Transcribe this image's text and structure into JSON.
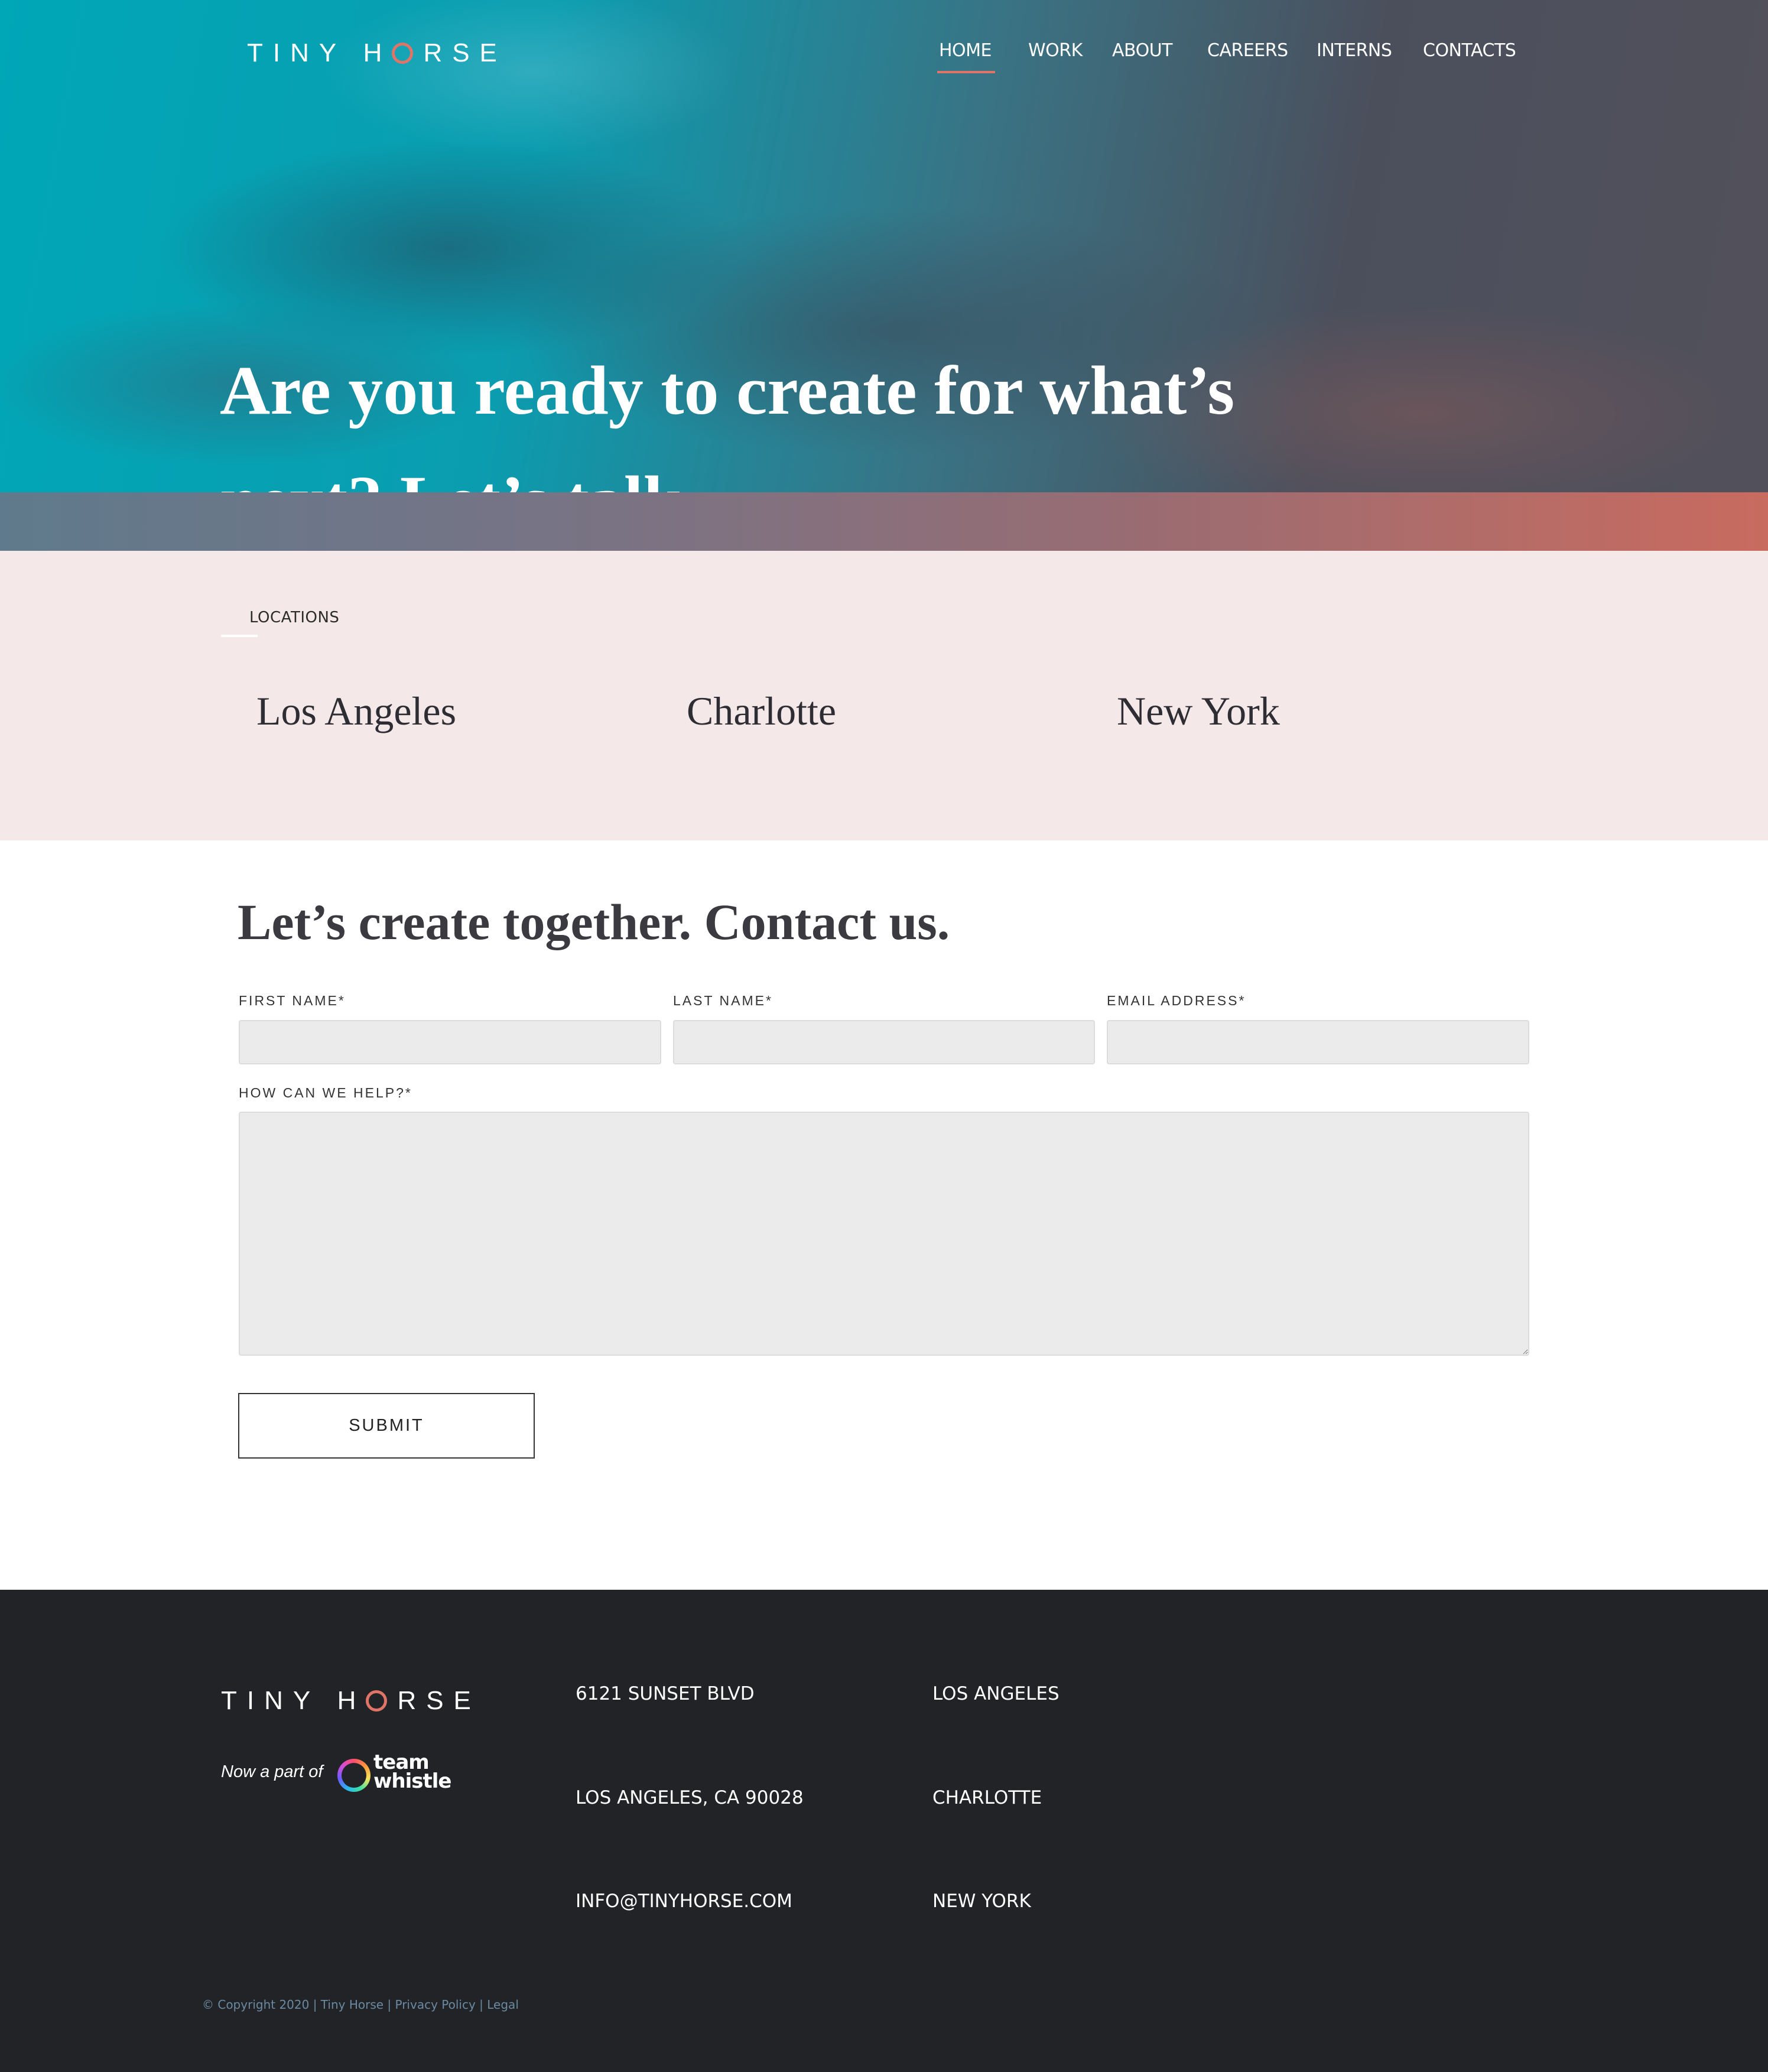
{
  "header": {
    "logo": {
      "before_o": "TINY H",
      "after_o": "RSE"
    },
    "nav": [
      {
        "label": "HOME",
        "active": true
      },
      {
        "label": "WORK",
        "active": false
      },
      {
        "label": "ABOUT",
        "active": false
      },
      {
        "label": "CAREERS",
        "active": false
      },
      {
        "label": "INTERNS",
        "active": false
      },
      {
        "label": "CONTACTS",
        "active": false
      }
    ]
  },
  "hero": {
    "heading": "Are you ready to create for what’s next? Let’s talk."
  },
  "locations": {
    "label": "LOCATIONS",
    "cities": [
      "Los Angeles",
      "Charlotte",
      "New York"
    ]
  },
  "contact_form": {
    "title": "Let’s create together. Contact us.",
    "first_name": {
      "label": "FIRST NAME*",
      "value": ""
    },
    "last_name": {
      "label": "LAST NAME*",
      "value": ""
    },
    "email": {
      "label": "EMAIL ADDRESS*",
      "value": ""
    },
    "message": {
      "label": "HOW CAN WE HELP?*",
      "value": ""
    },
    "submit_label": "SUBMIT"
  },
  "footer": {
    "logo": {
      "before_o": "TINY H",
      "after_o": "RSE"
    },
    "now_part_of": "Now a part of",
    "partner": {
      "line1": "team",
      "line2": "whistle"
    },
    "address": [
      "6121 SUNSET BLVD",
      "LOS ANGELES, CA 90028",
      "INFO@TINYHORSE.COM"
    ],
    "cities": [
      "LOS ANGELES",
      "CHARLOTTE",
      "NEW YORK"
    ],
    "copyright": "© Copyright 2020 | Tiny Horse | ",
    "privacy": "Privacy Policy",
    "separator": " | ",
    "legal": "Legal"
  },
  "colors": {
    "accent": "#e07466",
    "locations_bg": "#f4e8e8",
    "footer_bg": "#222327"
  }
}
